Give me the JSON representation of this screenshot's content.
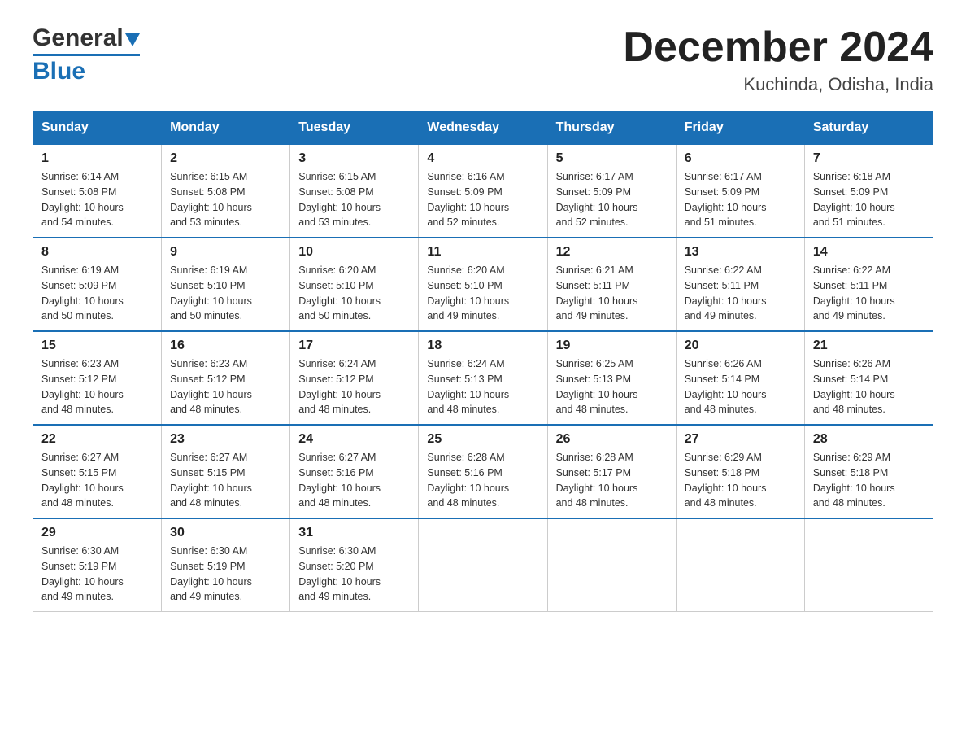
{
  "logo": {
    "general": "General",
    "blue": "Blue"
  },
  "header": {
    "month": "December 2024",
    "location": "Kuchinda, Odisha, India"
  },
  "weekdays": [
    "Sunday",
    "Monday",
    "Tuesday",
    "Wednesday",
    "Thursday",
    "Friday",
    "Saturday"
  ],
  "weeks": [
    [
      {
        "day": "1",
        "sunrise": "6:14 AM",
        "sunset": "5:08 PM",
        "daylight": "10 hours and 54 minutes."
      },
      {
        "day": "2",
        "sunrise": "6:15 AM",
        "sunset": "5:08 PM",
        "daylight": "10 hours and 53 minutes."
      },
      {
        "day": "3",
        "sunrise": "6:15 AM",
        "sunset": "5:08 PM",
        "daylight": "10 hours and 53 minutes."
      },
      {
        "day": "4",
        "sunrise": "6:16 AM",
        "sunset": "5:09 PM",
        "daylight": "10 hours and 52 minutes."
      },
      {
        "day": "5",
        "sunrise": "6:17 AM",
        "sunset": "5:09 PM",
        "daylight": "10 hours and 52 minutes."
      },
      {
        "day": "6",
        "sunrise": "6:17 AM",
        "sunset": "5:09 PM",
        "daylight": "10 hours and 51 minutes."
      },
      {
        "day": "7",
        "sunrise": "6:18 AM",
        "sunset": "5:09 PM",
        "daylight": "10 hours and 51 minutes."
      }
    ],
    [
      {
        "day": "8",
        "sunrise": "6:19 AM",
        "sunset": "5:09 PM",
        "daylight": "10 hours and 50 minutes."
      },
      {
        "day": "9",
        "sunrise": "6:19 AM",
        "sunset": "5:10 PM",
        "daylight": "10 hours and 50 minutes."
      },
      {
        "day": "10",
        "sunrise": "6:20 AM",
        "sunset": "5:10 PM",
        "daylight": "10 hours and 50 minutes."
      },
      {
        "day": "11",
        "sunrise": "6:20 AM",
        "sunset": "5:10 PM",
        "daylight": "10 hours and 49 minutes."
      },
      {
        "day": "12",
        "sunrise": "6:21 AM",
        "sunset": "5:11 PM",
        "daylight": "10 hours and 49 minutes."
      },
      {
        "day": "13",
        "sunrise": "6:22 AM",
        "sunset": "5:11 PM",
        "daylight": "10 hours and 49 minutes."
      },
      {
        "day": "14",
        "sunrise": "6:22 AM",
        "sunset": "5:11 PM",
        "daylight": "10 hours and 49 minutes."
      }
    ],
    [
      {
        "day": "15",
        "sunrise": "6:23 AM",
        "sunset": "5:12 PM",
        "daylight": "10 hours and 48 minutes."
      },
      {
        "day": "16",
        "sunrise": "6:23 AM",
        "sunset": "5:12 PM",
        "daylight": "10 hours and 48 minutes."
      },
      {
        "day": "17",
        "sunrise": "6:24 AM",
        "sunset": "5:12 PM",
        "daylight": "10 hours and 48 minutes."
      },
      {
        "day": "18",
        "sunrise": "6:24 AM",
        "sunset": "5:13 PM",
        "daylight": "10 hours and 48 minutes."
      },
      {
        "day": "19",
        "sunrise": "6:25 AM",
        "sunset": "5:13 PM",
        "daylight": "10 hours and 48 minutes."
      },
      {
        "day": "20",
        "sunrise": "6:26 AM",
        "sunset": "5:14 PM",
        "daylight": "10 hours and 48 minutes."
      },
      {
        "day": "21",
        "sunrise": "6:26 AM",
        "sunset": "5:14 PM",
        "daylight": "10 hours and 48 minutes."
      }
    ],
    [
      {
        "day": "22",
        "sunrise": "6:27 AM",
        "sunset": "5:15 PM",
        "daylight": "10 hours and 48 minutes."
      },
      {
        "day": "23",
        "sunrise": "6:27 AM",
        "sunset": "5:15 PM",
        "daylight": "10 hours and 48 minutes."
      },
      {
        "day": "24",
        "sunrise": "6:27 AM",
        "sunset": "5:16 PM",
        "daylight": "10 hours and 48 minutes."
      },
      {
        "day": "25",
        "sunrise": "6:28 AM",
        "sunset": "5:16 PM",
        "daylight": "10 hours and 48 minutes."
      },
      {
        "day": "26",
        "sunrise": "6:28 AM",
        "sunset": "5:17 PM",
        "daylight": "10 hours and 48 minutes."
      },
      {
        "day": "27",
        "sunrise": "6:29 AM",
        "sunset": "5:18 PM",
        "daylight": "10 hours and 48 minutes."
      },
      {
        "day": "28",
        "sunrise": "6:29 AM",
        "sunset": "5:18 PM",
        "daylight": "10 hours and 48 minutes."
      }
    ],
    [
      {
        "day": "29",
        "sunrise": "6:30 AM",
        "sunset": "5:19 PM",
        "daylight": "10 hours and 49 minutes."
      },
      {
        "day": "30",
        "sunrise": "6:30 AM",
        "sunset": "5:19 PM",
        "daylight": "10 hours and 49 minutes."
      },
      {
        "day": "31",
        "sunrise": "6:30 AM",
        "sunset": "5:20 PM",
        "daylight": "10 hours and 49 minutes."
      },
      null,
      null,
      null,
      null
    ]
  ],
  "labels": {
    "sunrise": "Sunrise:",
    "sunset": "Sunset:",
    "daylight": "Daylight:"
  }
}
